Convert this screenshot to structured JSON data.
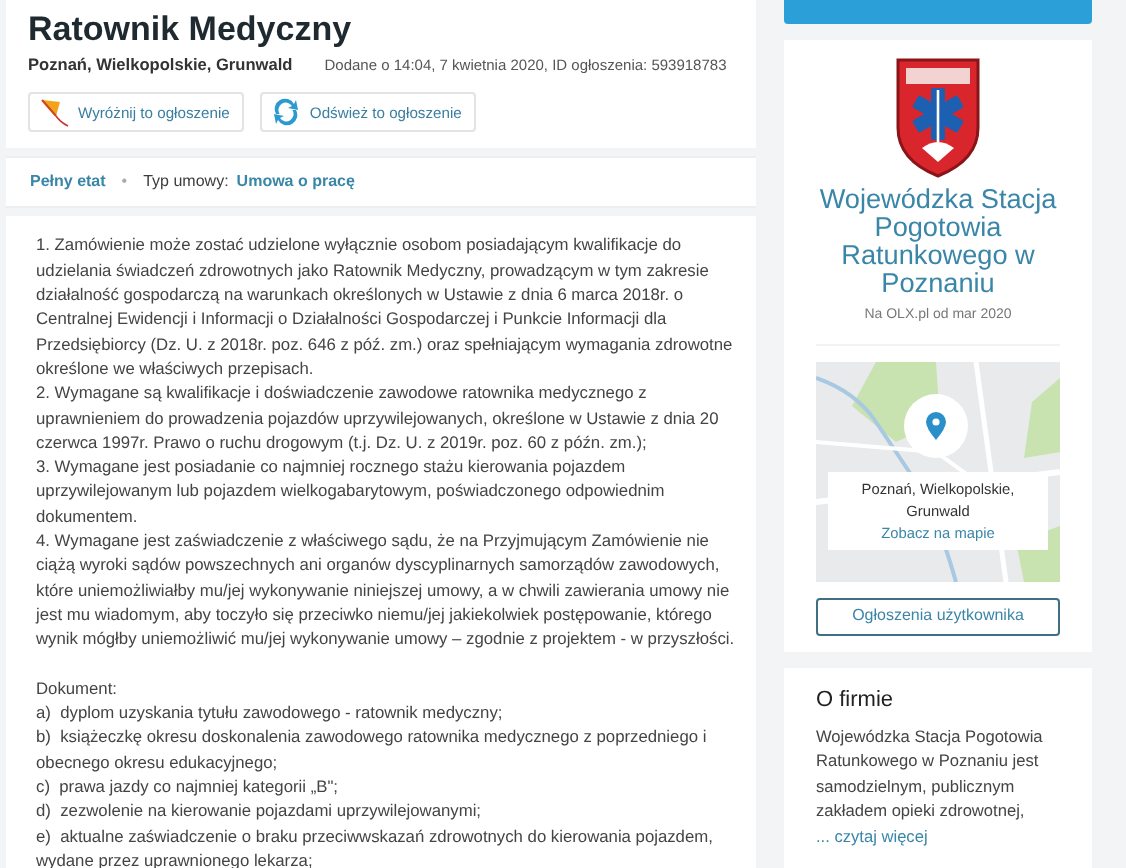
{
  "header": {
    "title": "Ratownik Medyczny",
    "location": "Poznań, Wielkopolskie, Grunwald",
    "added": "Dodane o 14:04, 7 kwietnia 2020, ID ogłoszenia: 593918783"
  },
  "actions": [
    {
      "kind": "kite",
      "label": "Wyróżnij to ogłoszenie"
    },
    {
      "kind": "refresh",
      "label": "Odśwież to ogłoszenie"
    }
  ],
  "tags": {
    "employment": "Pełny etat",
    "separator": "•",
    "contract_label": "Typ umowy:",
    "contract_value": "Umowa o pracę"
  },
  "description": {
    "paragraphs": [
      "1. Zamówienie może zostać udzielone wyłącznie osobom posiadającym kwalifikacje do udzielania świadczeń zdrowotnych jako Ratownik Medyczny, prowadzącym w tym zakresie działalność gospodarczą na warunkach określonych w Ustawie z dnia 6 marca 2018r. o Centralnej Ewidencji i Informacji o Działalności Gospodarczej i Punkcie Informacji dla Przedsiębiorcy (Dz. U. z 2018r. poz. 646 z póź. zm.) oraz spełniającym wymagania zdrowotne określone we właściwych przepisach.",
      "2. Wymagane są kwalifikacje i doświadczenie zawodowe ratownika medycznego z uprawnieniem do prowadzenia pojazdów uprzywilejowanych, określone w Ustawie z dnia 20 czerwca 1997r. Prawo o ruchu drogowym (t.j. Dz. U. z 2019r. poz. 60 z późn. zm.);",
      "3. Wymagane jest posiadanie co najmniej rocznego stażu kierowania pojazdem uprzywilejowanym lub pojazdem wielkogabarytowym, poświadczonego odpowiednim dokumentem.",
      "4. Wymagane jest zaświadczenie z właściwego sądu, że na Przyjmującym Zamówienie nie ciążą wyroki sądów powszechnych ani organów dyscyplinarnych samorządów zawodowych, które uniemożliwiałby mu/jej wykonywanie niniejszej umowy, a w chwili zawierania umowy nie jest mu wiadomym, aby toczyło się przeciwko niemu/jej jakiekolwiek postępowanie, którego wynik mógłby uniemożliwić mu/jej wykonywanie umowy – zgodnie z projektem - w przyszłości."
    ],
    "documents_heading": "Dokument:",
    "documents": [
      "a)  dyplom uzyskania tytułu zawodowego - ratownik medyczny;",
      "b)  książeczkę okresu doskonalenia zawodowego ratownika medycznego z poprzedniego i obecnego okresu edukacyjnego;",
      "c)  prawa jazdy co najmniej kategorii „B\";",
      "d)  zezwolenie na kierowanie pojazdami uprzywilejowanymi;",
      "e)  aktualne zaświadczenie o braku przeciwwskazań zdrowotnych do kierowania pojazdem, wydane przez uprawnionego lekarza;"
    ]
  },
  "seller": {
    "name": "Wojewódzka Stacja Pogotowia Ratunkowego w Poznaniu",
    "since": "Na OLX.pl od mar 2020"
  },
  "map": {
    "location": "Poznań, Wielkopolskie, Grunwald",
    "link": "Zobacz na mapie"
  },
  "user_ads_button": "Ogłoszenia użytkownika",
  "about": {
    "title": "O firmie",
    "text": "Wojewódzka Stacja Pogotowia Ratunkowego w Poznaniu jest samodzielnym, publicznym zakładem opieki zdrowotnej,",
    "more_link": "... czytaj więcej"
  }
}
